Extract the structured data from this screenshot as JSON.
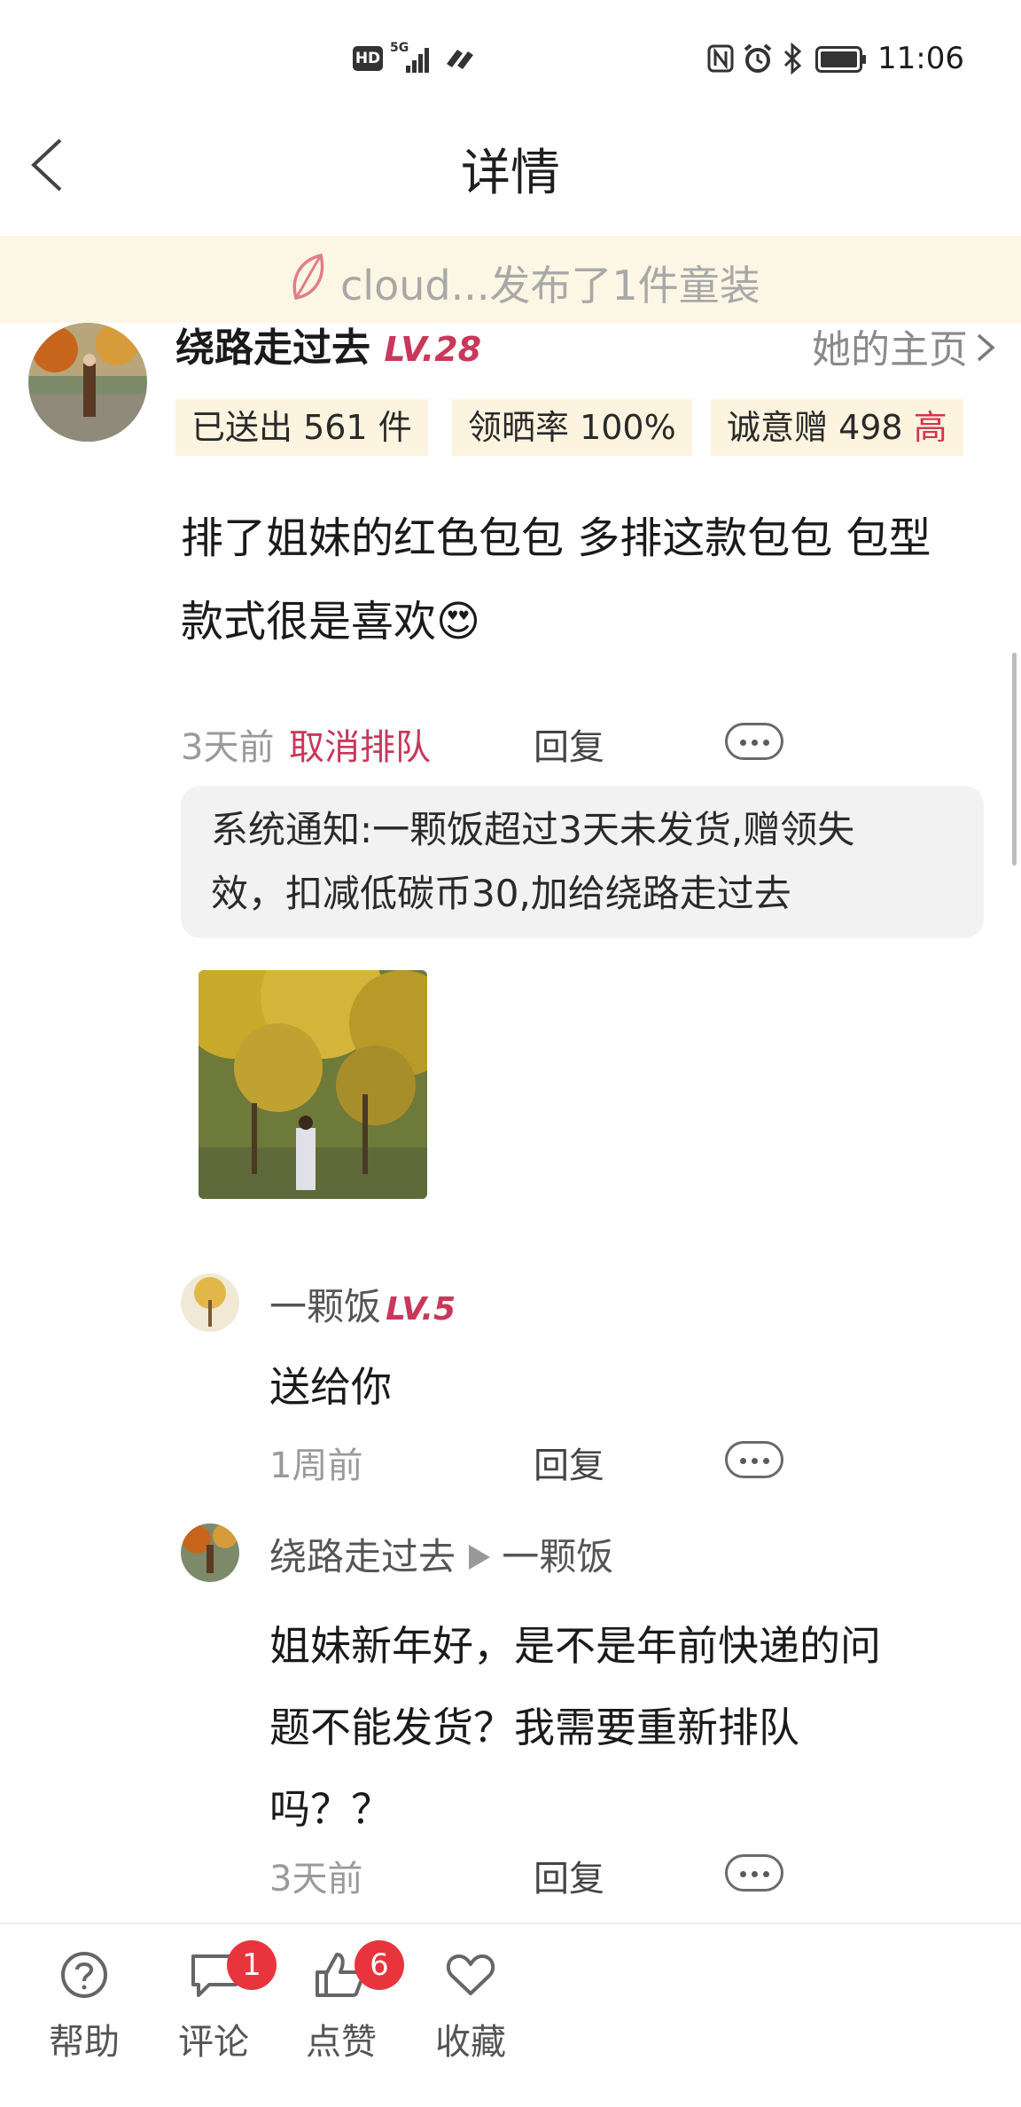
{
  "status_bar": {
    "hd": "HD",
    "net": "5G",
    "time": "11:06"
  },
  "header": {
    "title": "详情"
  },
  "banner": {
    "text": "cloud...发布了1件童装"
  },
  "profile": {
    "name": "绕路走过去",
    "level": "LV.28",
    "homepage_label": "她的主页",
    "stats": {
      "sent": "已送出 561 件",
      "rate": "领晒率 100%",
      "sincerity": "诚意赠 498 ",
      "sincerity_level": "高"
    }
  },
  "post": {
    "line1": "排了姐妹的红色包包 多排这款包包 包型",
    "line2": "款式很是喜欢😍",
    "time": "3天前",
    "cancel_label": "取消排队",
    "reply_label": "回复"
  },
  "system_notice": {
    "line1": "系统通知:一颗饭超过3天未发货,赠领失",
    "line2": "效，扣减低碳币30,加给绕路走过去"
  },
  "comments": [
    {
      "name": "一颗饭",
      "level": "LV.5",
      "text": "送给你",
      "time": "1周前",
      "reply_label": "回复"
    },
    {
      "name": "绕路走过去",
      "to": "一颗饭",
      "line1": "姐妹新年好，是不是年前快递的问",
      "line2": "题不能发货？我需要重新排队",
      "line3": "吗？？",
      "time": "3天前",
      "reply_label": "回复"
    }
  ],
  "tabbar": {
    "items": [
      {
        "label": "帮助",
        "icon": "help-icon"
      },
      {
        "label": "评论",
        "icon": "comment-icon",
        "badge": "1"
      },
      {
        "label": "点赞",
        "icon": "thumbs-up-icon",
        "badge": "6"
      },
      {
        "label": "收藏",
        "icon": "heart-icon"
      }
    ]
  },
  "colors": {
    "accent": "#c8385a",
    "banner_bg": "#fcf6e4",
    "stat_bg": "#fdf4df",
    "badge": "#e8343d"
  }
}
